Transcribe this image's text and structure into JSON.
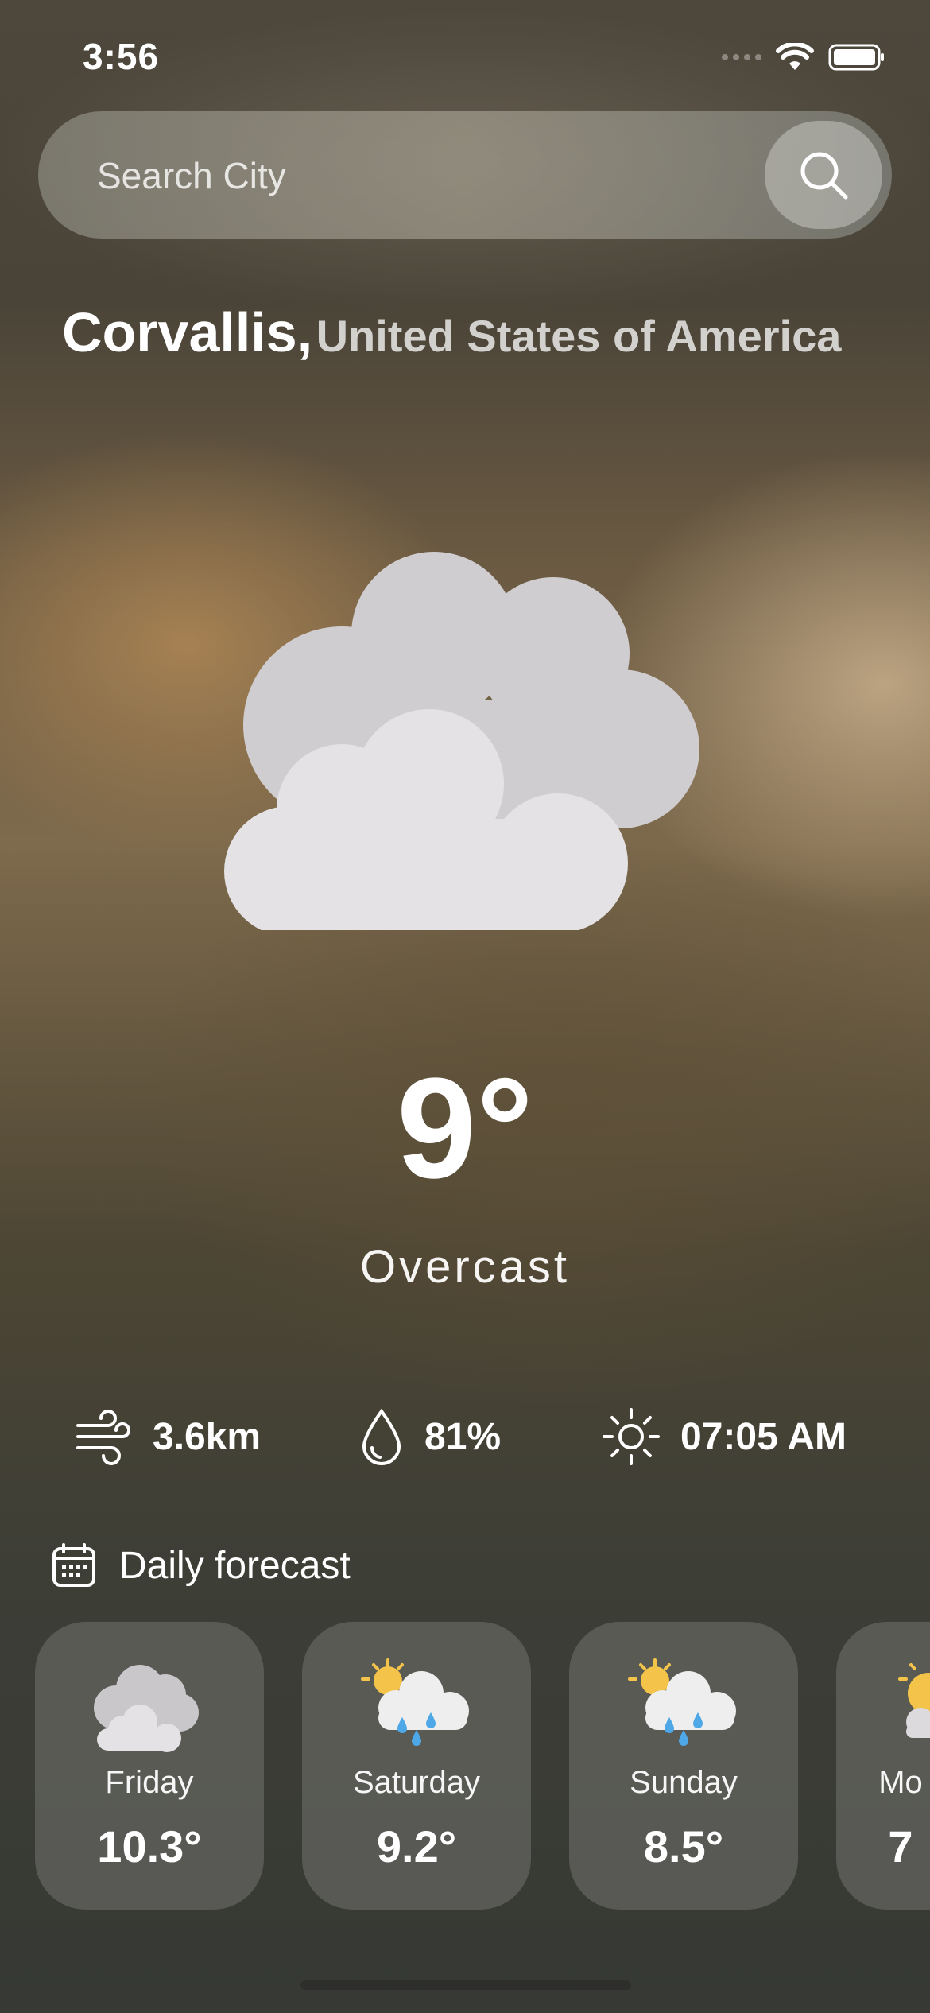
{
  "status_bar": {
    "time": "3:56"
  },
  "search": {
    "placeholder": "Search City"
  },
  "location": {
    "city": "Corvallis,",
    "country": "United States of America"
  },
  "current": {
    "temperature": "9°",
    "condition": "Overcast",
    "icon": "overcast-clouds-icon"
  },
  "stats": {
    "wind": "3.6km",
    "humidity": "81%",
    "sunrise": "07:05 AM"
  },
  "forecast": {
    "title": "Daily forecast",
    "days": [
      {
        "day": "Friday",
        "temp": "10.3°",
        "icon": "cloudy-icon"
      },
      {
        "day": "Saturday",
        "temp": "9.2°",
        "icon": "sun-rain-cloud-icon"
      },
      {
        "day": "Sunday",
        "temp": "8.5°",
        "icon": "sun-rain-cloud-icon"
      },
      {
        "day": "Mo",
        "temp": "7",
        "icon": "sun-cloud-icon"
      }
    ]
  }
}
